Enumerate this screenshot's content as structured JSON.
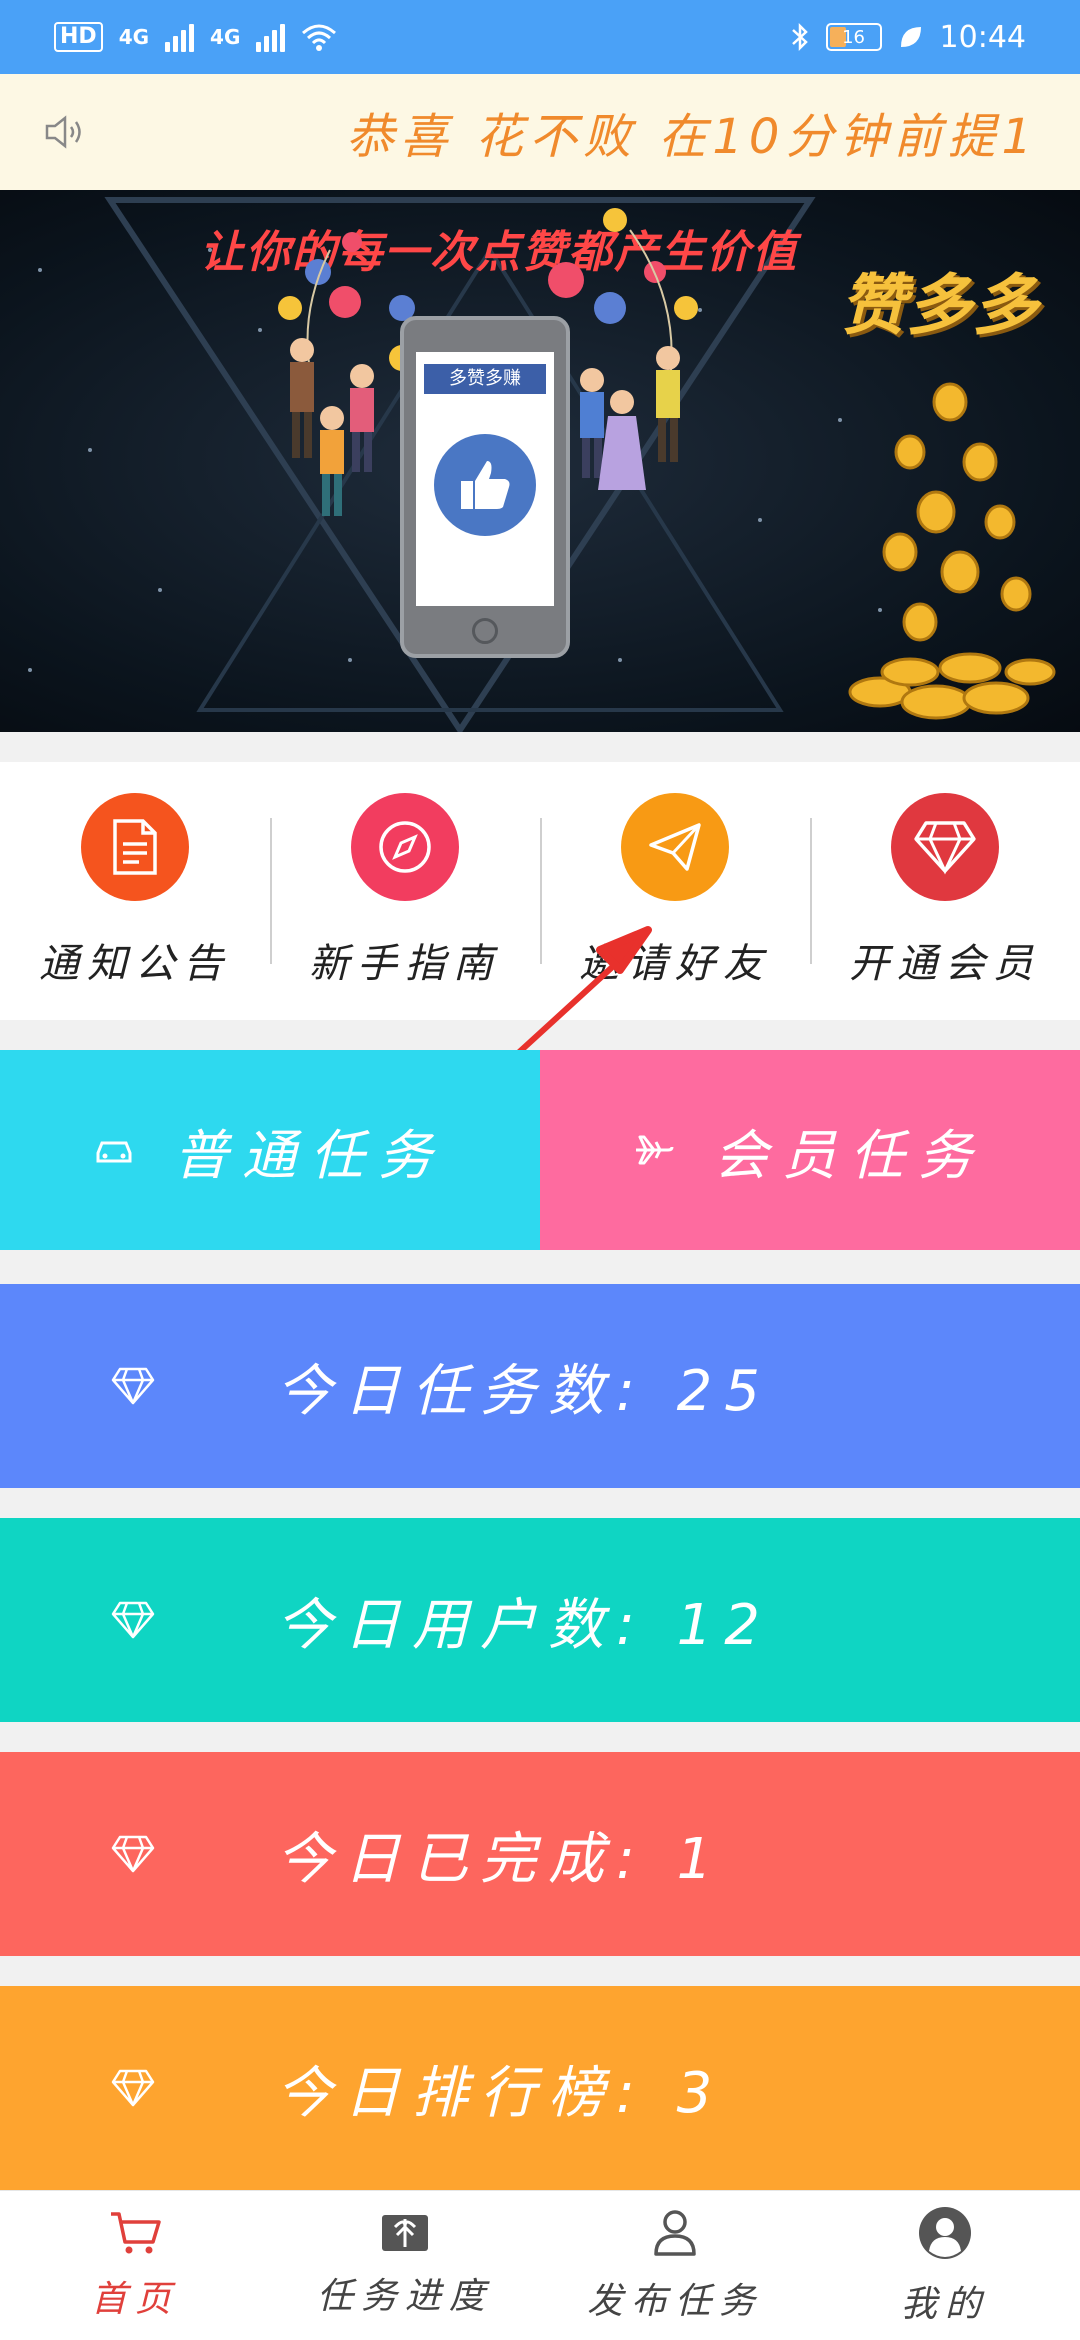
{
  "status_bar": {
    "left_badges": [
      "HD",
      "4G",
      "4G"
    ],
    "battery": "16",
    "time": "10:44"
  },
  "notice": {
    "icon": "speaker-icon",
    "text": "恭喜 花不败 在10分钟前提1"
  },
  "banner": {
    "slogan": "让你的每一次点赞都产生价值",
    "brand": "赞多多",
    "phone_label": "多赞多赚"
  },
  "quick_menu": [
    {
      "label": "通知公告",
      "icon": "document-icon",
      "color": "#f5541e"
    },
    {
      "label": "新手指南",
      "icon": "compass-icon",
      "color": "#f23d5f"
    },
    {
      "label": "邀请好友",
      "icon": "paper-plane-icon",
      "color": "#f89a14"
    },
    {
      "label": "开通会员",
      "icon": "diamond-icon",
      "color": "#e0383f"
    }
  ],
  "task_tabs": {
    "normal": {
      "label": "普通任务",
      "icon": "car-icon",
      "color": "#2ed9ef"
    },
    "member": {
      "label": "会员任务",
      "icon": "plane-icon",
      "color": "#fe6b9f"
    }
  },
  "stats": [
    {
      "text": "今日任务数: 25",
      "color": "#5c87fb"
    },
    {
      "text": "今日用户数: 12",
      "color": "#0fd5c3"
    },
    {
      "text": "今日已完成: 1",
      "color": "#fd665e"
    },
    {
      "text": "今日排行榜: 3",
      "color": "#fea42f"
    }
  ],
  "bottom_nav": [
    {
      "label": "首页",
      "icon": "cart-icon",
      "active": true
    },
    {
      "label": "任务进度",
      "icon": "gift-box-icon",
      "active": false
    },
    {
      "label": "发布任务",
      "icon": "user-icon",
      "active": false
    },
    {
      "label": "我的",
      "icon": "avatar-icon",
      "active": false
    }
  ],
  "accent_color": "#4aa1f7"
}
